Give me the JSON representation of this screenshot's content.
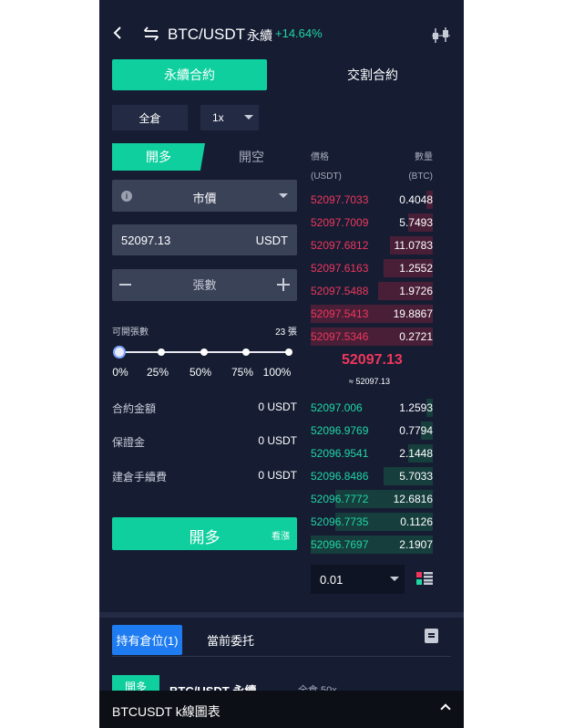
{
  "header": {
    "pair": "BTC/USDT",
    "type": "永續",
    "change": "+14.64%"
  },
  "contract_tabs": [
    {
      "label": "永續合約",
      "active": true
    },
    {
      "label": "交割合約",
      "active": false
    }
  ],
  "margin_mode": "全倉",
  "leverage": "1x",
  "side_tabs": [
    {
      "label": "開多",
      "active": true
    },
    {
      "label": "開空",
      "active": false
    }
  ],
  "order_type": "市價",
  "price_input": {
    "value": "52097.13",
    "unit": "USDT"
  },
  "quantity_input": {
    "placeholder": "張數"
  },
  "available": {
    "label": "可開張數",
    "value": "23 張"
  },
  "slider": {
    "value": 0,
    "marks": [
      "0%",
      "25%",
      "50%",
      "75%",
      "100%"
    ]
  },
  "info_rows": [
    {
      "label": "合約金額",
      "value": "0 USDT"
    },
    {
      "label": "保證金",
      "value": "0 USDT"
    },
    {
      "label": "建倉手續費",
      "value": "0 USDT"
    }
  ],
  "submit": {
    "label": "開多",
    "tag": "看漲"
  },
  "orderbook": {
    "price_header": "價格",
    "qty_header": "數量",
    "price_unit": "(USDT)",
    "qty_unit": "(BTC)",
    "asks": [
      {
        "price": "52097.7033",
        "qty": "0.4048",
        "depth": 0.05
      },
      {
        "price": "52097.7009",
        "qty": "5.7493",
        "depth": 0.2
      },
      {
        "price": "52097.6812",
        "qty": "11.0783",
        "depth": 0.35
      },
      {
        "price": "52097.6163",
        "qty": "1.2552",
        "depth": 0.4
      },
      {
        "price": "52097.5488",
        "qty": "1.9726",
        "depth": 0.45
      },
      {
        "price": "52097.5413",
        "qty": "19.8867",
        "depth": 1.0
      },
      {
        "price": "52097.5346",
        "qty": "0.2721",
        "depth": 1.0
      }
    ],
    "last_price": "52097.13",
    "last_price_approx": "≈ 52097.13",
    "bids": [
      {
        "price": "52097.006",
        "qty": "1.2593",
        "depth": 0.05
      },
      {
        "price": "52096.9769",
        "qty": "0.7794",
        "depth": 0.1
      },
      {
        "price": "52096.9541",
        "qty": "2.1448",
        "depth": 0.2
      },
      {
        "price": "52096.8486",
        "qty": "5.7033",
        "depth": 0.4
      },
      {
        "price": "52096.7772",
        "qty": "12.6816",
        "depth": 0.8
      },
      {
        "price": "52096.7735",
        "qty": "0.1126",
        "depth": 0.8
      },
      {
        "price": "52096.7697",
        "qty": "2.1907",
        "depth": 1.0
      }
    ],
    "precision": "0.01"
  },
  "bottom_tabs": [
    {
      "label": "持有倉位(1)",
      "active": true
    },
    {
      "label": "當前委托",
      "active": false
    }
  ],
  "position": {
    "side": "開多",
    "symbol": "BTC/USDT 永續",
    "mode": "全倉 50x"
  },
  "footer": {
    "label": "BTCUSDT  k線圖表"
  },
  "colors": {
    "accent": "#0fcf9f",
    "ask": "#f0365c",
    "bid": "#1fd6a4",
    "tab_blue": "#1e7cf0",
    "bg": "#161d33"
  },
  "icons": [
    "back-arrow-icon",
    "swap-icon",
    "kline-icon",
    "info-icon",
    "layout-icon",
    "document-icon",
    "chevron-up-icon"
  ]
}
